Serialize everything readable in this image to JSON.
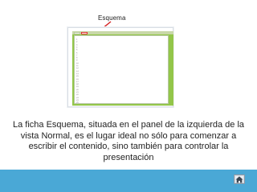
{
  "callout": {
    "label": "Esquema",
    "arrow_color": "#d32020"
  },
  "panel": {
    "tabs": [
      "",
      ""
    ],
    "outline_lines": [
      "1",
      "2",
      "3",
      "4",
      "5",
      "6",
      "7",
      "8",
      "9",
      "10",
      "11",
      "12",
      "13",
      "14",
      "15",
      "16",
      "17",
      "18",
      "19",
      "20",
      "21",
      "22",
      "23",
      "24",
      "25"
    ],
    "accent": "#93c64a"
  },
  "body": {
    "text": "La ficha Esquema, situada en el panel de la izquierda de la vista Normal, es el lugar ideal no sólo para comenzar a escribir el contenido, sino también para controlar la presentación"
  },
  "footer": {
    "bar_color": "#4aa8d6",
    "home_icon": "home-icon"
  }
}
